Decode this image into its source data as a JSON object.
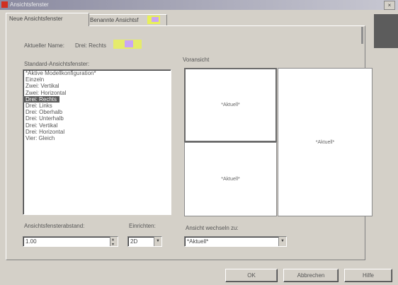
{
  "window": {
    "title": "Ansichtsfenster",
    "close_label": "×"
  },
  "tabs": [
    {
      "label": "Neue Ansichtsfenster"
    },
    {
      "label": "Benannte Ansichtsf"
    }
  ],
  "current_name": {
    "label": "Aktueller Name:",
    "value": "Drei: Rechts"
  },
  "standard_views": {
    "label": "Standard-Ansichtsfenster:",
    "items": [
      "*Aktive Modellkonfiguration*",
      "Einzeln",
      "Zwei: Vertikal",
      "Zwei: Horizontal",
      "Drei: Rechts",
      "Drei: Links",
      "Drei: Oberhalb",
      "Drei: Unterhalb",
      "Drei: Vertikal",
      "Drei: Horizontal",
      "Vier: Gleich"
    ],
    "selected_index": 4
  },
  "preview": {
    "label": "Voransicht",
    "viewports": [
      "*Aktuell*",
      "*Aktuell*",
      "*Aktuell*"
    ]
  },
  "apply_to": {
    "label": "Ansichtsfensterabstand:",
    "value": "1.00"
  },
  "setup": {
    "label": "Einrichten:",
    "value": "2D"
  },
  "change_view": {
    "label": "Ansicht wechseln zu:",
    "value": "*Aktuell*"
  },
  "buttons": {
    "ok": "OK",
    "cancel": "Abbrechen",
    "help": "Hilfe"
  }
}
